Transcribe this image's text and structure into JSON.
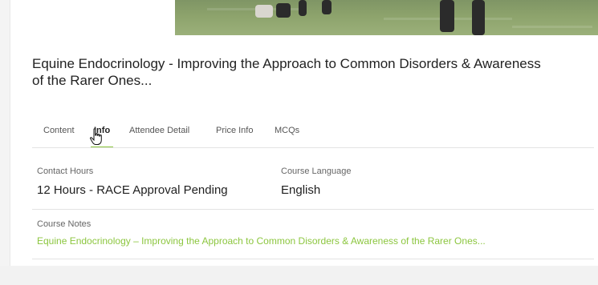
{
  "course": {
    "title": "Equine Endocrinology - Improving the Approach to Common Disorders & Awareness of the Rarer Ones..."
  },
  "tabs": [
    {
      "label": "Content"
    },
    {
      "label": "Info",
      "active": true
    },
    {
      "label": "Attendee Detail"
    },
    {
      "label": "Price Info"
    },
    {
      "label": "MCQs"
    }
  ],
  "info": {
    "contact_hours_label": "Contact Hours",
    "contact_hours_value": "12 Hours - RACE Approval Pending",
    "course_language_label": "Course Language",
    "course_language_value": "English",
    "course_notes_label": "Course Notes",
    "course_notes_value": "Equine Endocrinology – Improving the Approach to Common Disorders & Awareness of the Rarer Ones..."
  },
  "colors": {
    "accent": "#8cc63f",
    "text": "#222222",
    "muted": "#666666"
  },
  "icons": {
    "cursor": "hand-pointer-icon"
  }
}
